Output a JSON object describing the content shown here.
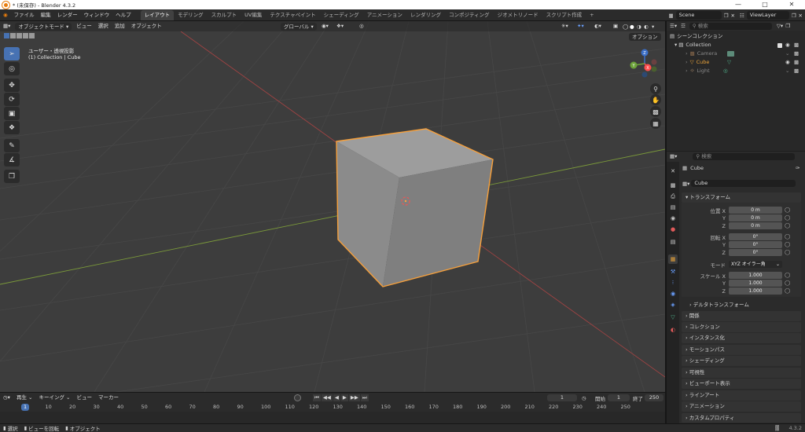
{
  "window": {
    "title": "* (未保存) - Blender 4.3.2"
  },
  "menus": [
    "ファイル",
    "編集",
    "レンダー",
    "ウィンドウ",
    "ヘルプ"
  ],
  "workspaces": [
    "レイアウト",
    "モデリング",
    "スカルプト",
    "UV編集",
    "テクスチャペイント",
    "シェーディング",
    "アニメーション",
    "レンダリング",
    "コンポジティング",
    "ジオメトリノード",
    "スクリプト作成"
  ],
  "scene": {
    "name": "Scene",
    "view_layer": "ViewLayer"
  },
  "viewport": {
    "mode": "オブジェクトモード",
    "menu": [
      "ビュー",
      "選択",
      "追加",
      "オブジェクト"
    ],
    "transform_orientation": "グローバル",
    "options": "オプション",
    "overlay_title": "ユーザー・透視投影",
    "overlay_sub": "(1) Collection | Cube",
    "gizmo": {
      "x": "X",
      "y": "Y",
      "z": "Z"
    }
  },
  "outliner": {
    "search_placeholder": "検索",
    "scene_collection": "シーンコレクション",
    "collection": "Collection",
    "objects": [
      {
        "name": "Camera",
        "color": "#6a8fb0"
      },
      {
        "name": "Cube",
        "color": "#e8a23a"
      },
      {
        "name": "Light",
        "color": "#a08266"
      }
    ]
  },
  "properties": {
    "search_placeholder": "検索",
    "object_name": "Cube",
    "object_field": "Cube",
    "transform_header": "トランスフォーム",
    "location_label": "位置 X",
    "rotation_label": "回転 X",
    "scale_label": "スケール X",
    "y_label": "Y",
    "z_label": "Z",
    "mode_label": "モード",
    "location": [
      "0 m",
      "0 m",
      "0 m"
    ],
    "rotation": [
      "0°",
      "0°",
      "0°"
    ],
    "rotation_mode": "XYZ オイラー角",
    "scale": [
      "1.000",
      "1.000",
      "1.000"
    ],
    "delta_transform": "デルタトランスフォーム",
    "sections": [
      "関係",
      "コレクション",
      "インスタンス化",
      "モーションパス",
      "シェーディング",
      "可視性",
      "ビューポート表示",
      "ラインアート",
      "アニメーション",
      "カスタムプロパティ"
    ]
  },
  "timeline": {
    "menu": [
      "再生",
      "キーイング",
      "ビュー",
      "マーカー"
    ],
    "current_frame": "1",
    "start_label": "開始",
    "start": "1",
    "end_label": "終了",
    "end": "250",
    "ticks": [
      "1",
      "10",
      "20",
      "30",
      "40",
      "50",
      "60",
      "70",
      "80",
      "90",
      "100",
      "110",
      "120",
      "130",
      "140",
      "150",
      "160",
      "170",
      "180",
      "190",
      "200",
      "210",
      "220",
      "230",
      "240",
      "250"
    ]
  },
  "statusbar": {
    "items": [
      "選択",
      "ビューを回転",
      "オブジェクト"
    ],
    "version": "4.3.2"
  }
}
